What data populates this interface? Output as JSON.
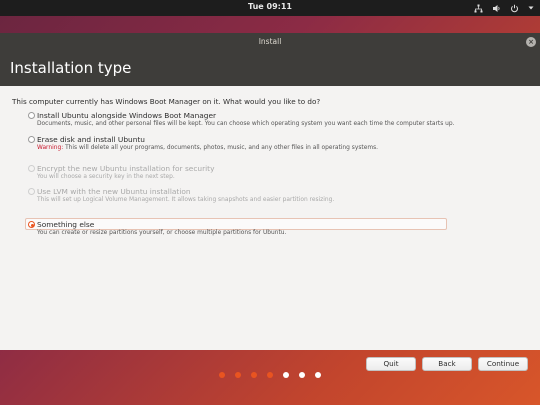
{
  "top_panel": {
    "clock": "Tue 09:11"
  },
  "window": {
    "title": "Install",
    "close_glyph": "×"
  },
  "header": {
    "title": "Installation type"
  },
  "question": "This computer currently has Windows Boot Manager on it. What would you like to do?",
  "options": [
    {
      "label": "Install Ubuntu alongside Windows Boot Manager",
      "desc": "Documents, music, and other personal files will be kept. You can choose which operating system you want each time the computer starts up.",
      "selected": false,
      "enabled": true
    },
    {
      "label": "Erase disk and install Ubuntu",
      "warning": "Warning:",
      "desc": "This will delete all your programs, documents, photos, music, and any other files in all operating systems.",
      "selected": false,
      "enabled": true
    },
    {
      "label": "Encrypt the new Ubuntu installation for security",
      "desc": "You will choose a security key in the next step.",
      "selected": false,
      "enabled": false
    },
    {
      "label": "Use LVM with the new Ubuntu installation",
      "desc": "This will set up Logical Volume Management. It allows taking snapshots and easier partition resizing.",
      "selected": false,
      "enabled": false
    },
    {
      "label": "Something else",
      "desc": "You can create or resize partitions yourself, or choose multiple partitions for Ubuntu.",
      "selected": true,
      "enabled": true
    }
  ],
  "buttons": {
    "quit": "Quit",
    "back": "Back",
    "continue": "Continue"
  },
  "progress": {
    "total_steps": 7,
    "current_step": 5
  },
  "colors": {
    "accent": "#e95420",
    "dot_done": "#e95420",
    "dot_pending": "#ffffff",
    "titlebar": "#3e3d3a"
  },
  "icons": [
    "network-icon",
    "volume-icon",
    "power-icon"
  ]
}
